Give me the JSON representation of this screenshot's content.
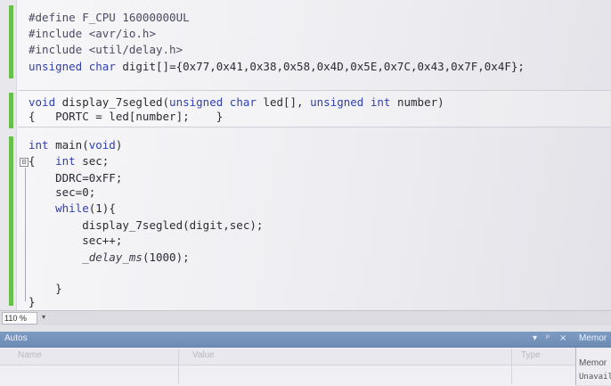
{
  "editor": {
    "lines": [
      {
        "parts": [
          [
            "pp",
            "#define F_CPU 16000000UL"
          ]
        ]
      },
      {
        "parts": [
          [
            "pp",
            "#include <avr/io.h>"
          ]
        ]
      },
      {
        "parts": [
          [
            "pp",
            "#include <util/delay.h>"
          ]
        ]
      },
      {
        "parts": [
          [
            "kw",
            "unsigned"
          ],
          [
            "nm",
            " "
          ],
          [
            "kw",
            "char"
          ],
          [
            "nm",
            " digit[]={0x77,0x41,0x38,0x58,0x4D,0x5E,0x7C,0x43,0x7F,0x4F};"
          ]
        ]
      },
      {
        "parts": [
          [
            "nm",
            ""
          ]
        ]
      },
      {
        "parts": [
          [
            "kw",
            "void"
          ],
          [
            "nm",
            " display_7segled("
          ],
          [
            "kw",
            "unsigned"
          ],
          [
            "nm",
            " "
          ],
          [
            "kw",
            "char"
          ],
          [
            "nm",
            " led[], "
          ],
          [
            "kw",
            "unsigned"
          ],
          [
            "nm",
            " "
          ],
          [
            "kw",
            "int"
          ],
          [
            "nm",
            " number)"
          ]
        ]
      },
      {
        "parts": [
          [
            "nm",
            "{   PORTC = led[number];    }"
          ]
        ]
      },
      {
        "parts": [
          [
            "nm",
            ""
          ]
        ]
      },
      {
        "parts": [
          [
            "kw",
            "int"
          ],
          [
            "nm",
            " main("
          ],
          [
            "kw",
            "void"
          ],
          [
            "nm",
            ")"
          ]
        ]
      },
      {
        "parts": [
          [
            "nm",
            "{   "
          ],
          [
            "kw",
            "int"
          ],
          [
            "nm",
            " sec;"
          ]
        ]
      },
      {
        "parts": [
          [
            "nm",
            "    DDRC=0xFF;"
          ]
        ]
      },
      {
        "parts": [
          [
            "nm",
            "    sec=0;"
          ]
        ]
      },
      {
        "parts": [
          [
            "nm",
            "    "
          ],
          [
            "kw",
            "while"
          ],
          [
            "nm",
            "(1){"
          ]
        ]
      },
      {
        "parts": [
          [
            "nm",
            "        display_7segled(digit,sec);"
          ]
        ]
      },
      {
        "parts": [
          [
            "nm",
            "        sec++;"
          ]
        ]
      },
      {
        "parts": [
          [
            "it",
            "        _delay_ms"
          ],
          [
            "nm",
            "(1000);"
          ]
        ]
      },
      {
        "parts": [
          [
            "nm",
            ""
          ]
        ]
      },
      {
        "parts": [
          [
            "nm",
            "    }"
          ]
        ]
      },
      {
        "parts": [
          [
            "nm",
            "}"
          ]
        ]
      }
    ]
  },
  "status": {
    "zoom": "110 %",
    "zoom_arrow": "▾"
  },
  "autos": {
    "title": "Autos",
    "columns": {
      "name": "Name",
      "value": "Value",
      "type": "Type"
    },
    "icons": {
      "pin": "▾",
      "dock": "ᵖ",
      "close": "×"
    }
  },
  "memory": {
    "title": "Memor",
    "sub": "Memor",
    "status": "Unavail"
  },
  "icons": {
    "collapse": "⊟"
  },
  "colors": {
    "change_bar": "#6abf4a",
    "keyword": "#2f3fb0",
    "panel_header": "#7e9cc4"
  }
}
